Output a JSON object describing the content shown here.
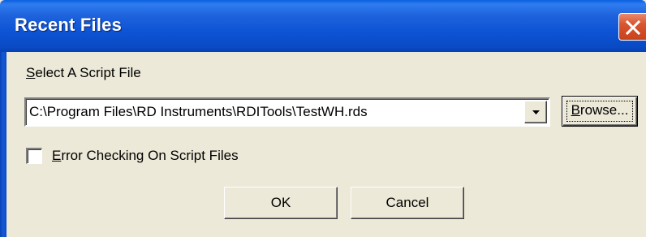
{
  "window": {
    "title": "Recent Files",
    "close_icon": "close-x-icon"
  },
  "select_label": {
    "pre": "",
    "accel": "S",
    "post": "elect A Script File"
  },
  "script_combo": {
    "value": "C:\\Program Files\\RD Instruments\\RDITools\\TestWH.rds",
    "arrow_icon": "chevron-down-icon"
  },
  "browse_button": {
    "accel": "B",
    "post": "rowse..."
  },
  "error_checkbox": {
    "checked": false,
    "accel": "E",
    "post": "rror Checking On Script Files"
  },
  "buttons": {
    "ok": "OK",
    "cancel": "Cancel"
  },
  "colors": {
    "titlebar": "#0a4ac4",
    "dialog_bg": "#ece9d8",
    "close_button": "#d8552f"
  }
}
